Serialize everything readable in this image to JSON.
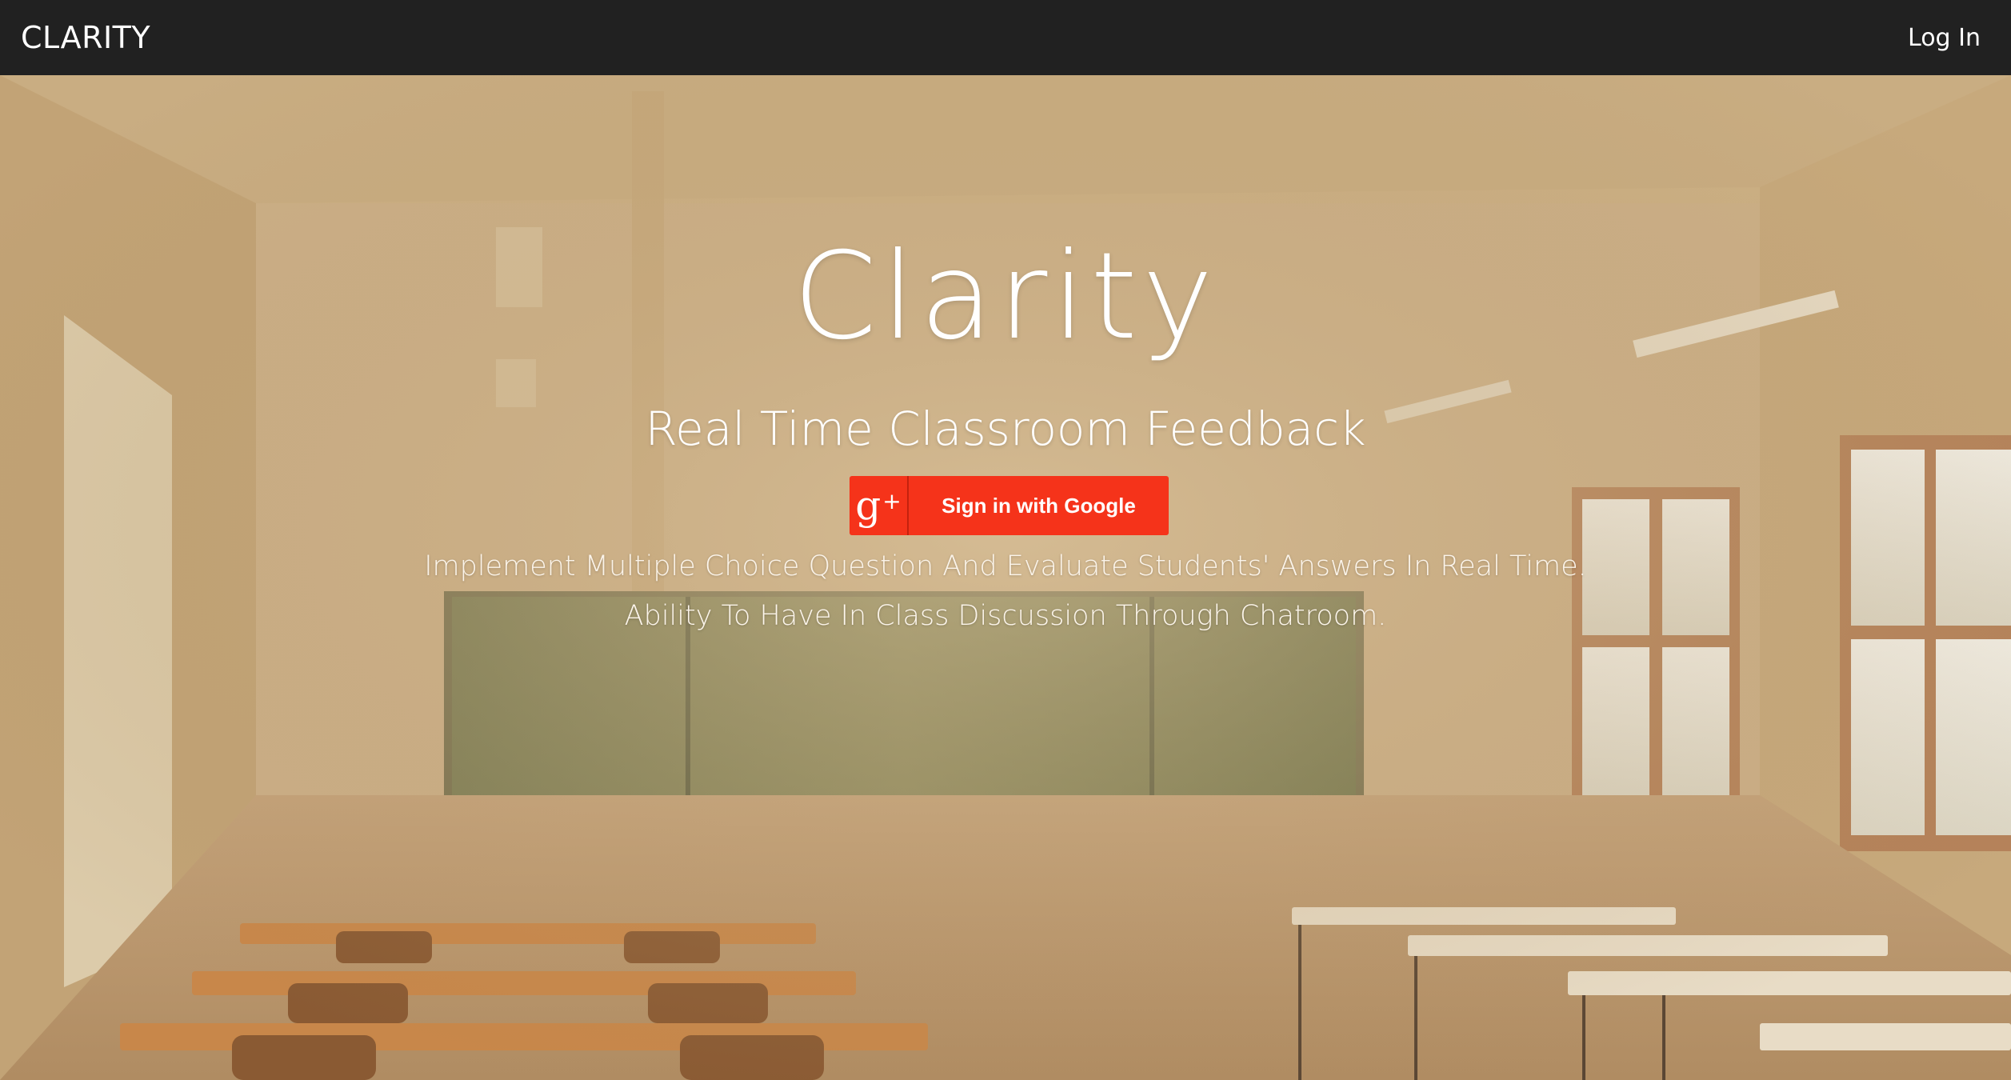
{
  "navbar": {
    "brand": "CLARITY",
    "login_label": "Log In"
  },
  "hero": {
    "title": "Clarity",
    "subtitle": "Real Time Classroom Feedback",
    "signin_button": {
      "icon_glyph": "g",
      "icon_plus": "+",
      "label": "Sign in with Google",
      "color": "#f5331a"
    },
    "description_lines": [
      "Implement Multiple Choice Question And Evaluate Students' Answers In Real Time.",
      "Ability To Have In Class Discussion Through Chatroom."
    ],
    "background": "classroom-illustration"
  },
  "colors": {
    "navbar_bg": "#212121",
    "accent": "#f5331a",
    "text": "#ffffff"
  }
}
